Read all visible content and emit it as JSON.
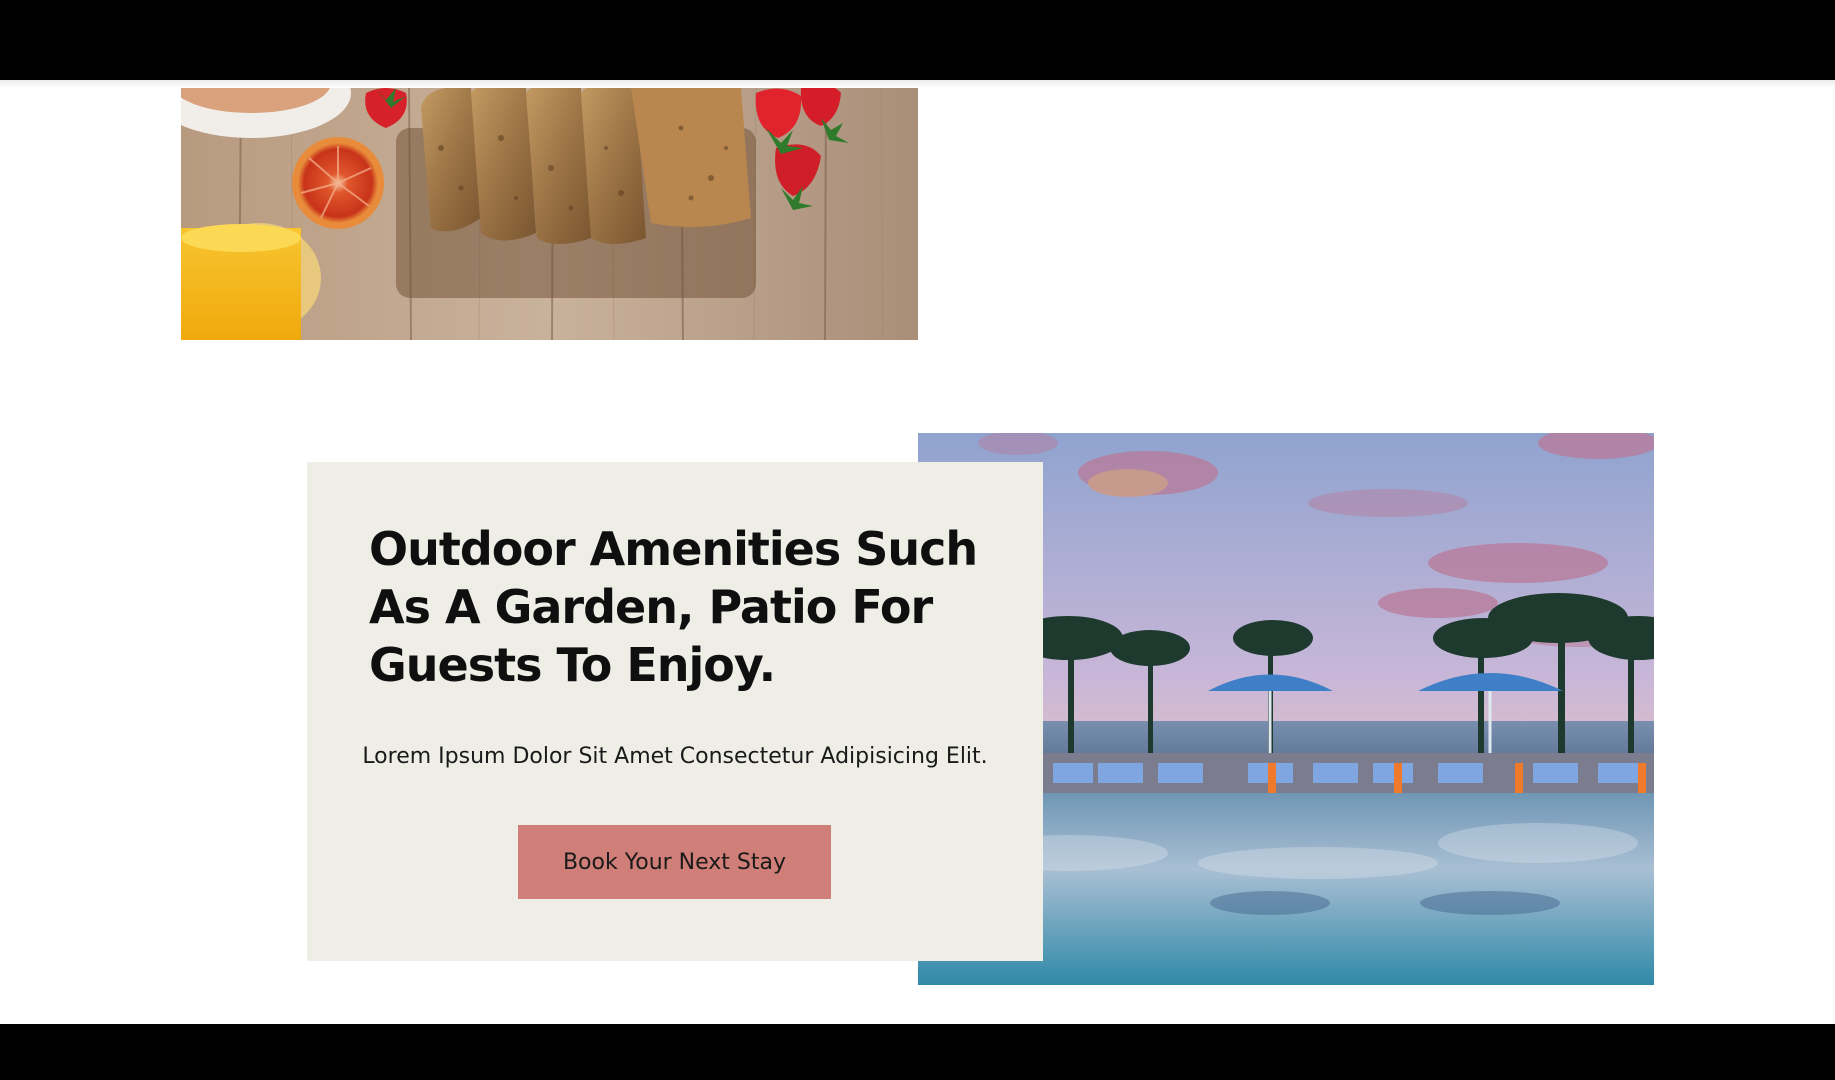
{
  "amenities": {
    "title": "Outdoor Amenities Such As A Garden, Patio For Guests To Enjoy.",
    "description": "Lorem Ipsum Dolor Sit Amet Consectetur Adipisicing Elit.",
    "cta_label": "Book Your Next Stay"
  },
  "colors": {
    "card_background": "#eeede6",
    "button_background": "#d07f78",
    "header_bar": "#000000",
    "footer_bar": "#000000"
  },
  "images": {
    "breakfast": "breakfast-photo",
    "pool": "pool-photo"
  }
}
